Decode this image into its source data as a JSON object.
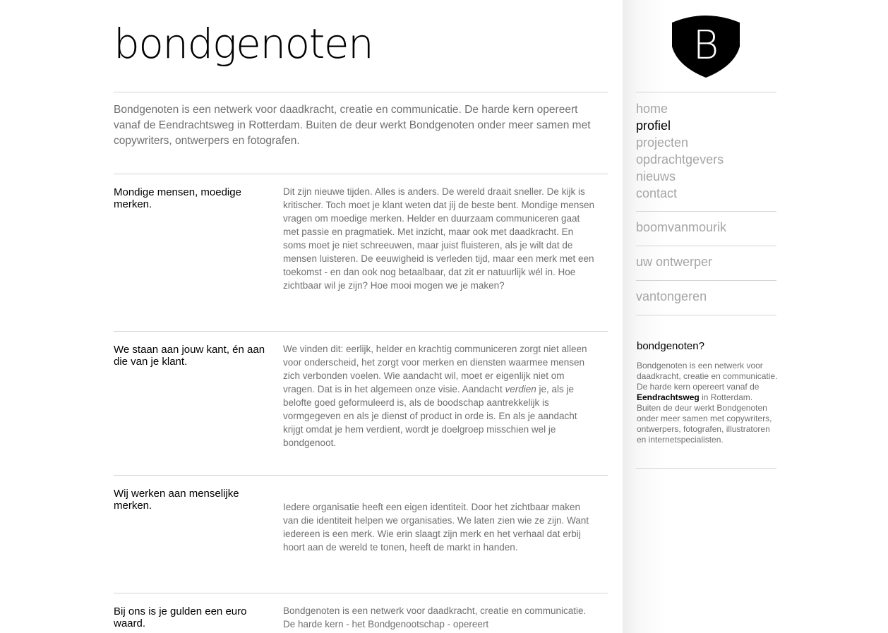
{
  "site": {
    "title": "bondgenoten",
    "logo_letter": "B",
    "intro": "Bondgenoten is een netwerk voor daadkracht, creatie en communicatie. De harde kern opereert vanaf de Eendrachtsweg in Rotterdam. Buiten de deur werkt Bondgenoten onder meer samen met copywriters, ontwerpers en fotografen."
  },
  "sections": [
    {
      "heading": "Mondige mensen, moedige merken.",
      "body": "Dit zijn nieuwe tijden. Alles is anders. De wereld draait sneller. De kijk is kritischer. Toch moet je klant weten dat jij de beste bent. Mondige mensen vragen om moedige merken. Helder en duurzaam communiceren gaat met passie en pragmatiek. Met inzicht, maar ook met daadkracht. En soms moet je niet schreeuwen, maar juist fluisteren, als je wilt dat de mensen luisteren. De eeuwigheid is verleden tijd, maar een merk met een toekomst - en dan ook nog betaalbaar, dat zit er natuurlijk wél in. Hoe zichtbaar wil je zijn? Hoe mooi mogen we je maken?"
    },
    {
      "heading": "We staan aan jouw kant, én aan die van je klant.",
      "body_before": "We vinden dit: eerlijk, helder en krachtig communiceren zorgt niet alleen voor onderscheid, het zorgt voor merken en diensten waarmee mensen zich verbonden voelen. Wie aandacht wil, moet er eigenlijk niet om vragen. Dat is in het algemeen onze visie. Aandacht ",
      "body_em": "verdien",
      "body_after": " je, als je belofte goed geformuleerd is, als de boodschap aantrekkelijk is vormgegeven en als je dienst of product in orde is. En als je aandacht krijgt omdat je hem verdient, wordt je doelgroep misschien wel je bondgenoot."
    },
    {
      "heading": "Wij werken aan menselijke merken.",
      "body": "Iedere organisatie heeft een eigen identiteit. Door het zichtbaar maken van die identiteit helpen we organisaties. We laten zien wie ze zijn. Want iedereen is een merk. Wie erin slaagt zijn merk en het verhaal dat erbij hoort aan de wereld te tonen, heeft de markt in handen."
    },
    {
      "heading": "Bij ons is je gulden een euro waard.",
      "body": "Bondgenoten is een netwerk voor daadkracht, creatie en communicatie. De harde kern - het Bondgenootschap - opereert"
    }
  ],
  "nav": {
    "items": [
      {
        "label": "home",
        "active": false
      },
      {
        "label": "profiel",
        "active": true
      },
      {
        "label": "projecten",
        "active": false
      },
      {
        "label": "opdrachtgevers",
        "active": false
      },
      {
        "label": "nieuws",
        "active": false
      },
      {
        "label": "contact",
        "active": false
      }
    ],
    "external": [
      "boomvanmourik",
      "uw ontwerper",
      "vantongeren"
    ]
  },
  "about": {
    "title": "bondgenoten?",
    "text_before": "Bondgenoten is een netwerk voor daadkracht, creatie en communicatie. De harde kern opereert vanaf de ",
    "text_bold": "Eendrachtsweg",
    "text_mid": " in Rotterdam.",
    "text_after": "Buiten de deur werkt Bondgenoten onder meer samen met copywriters, ontwerpers, fotografen, illustratoren en internetspecialisten."
  },
  "colors": {
    "nav_active": "#000000",
    "nav_inactive": "#a5a5a5",
    "body_text": "#6f6f6f",
    "rule": "#d4d4d4",
    "logo": "#000000"
  }
}
